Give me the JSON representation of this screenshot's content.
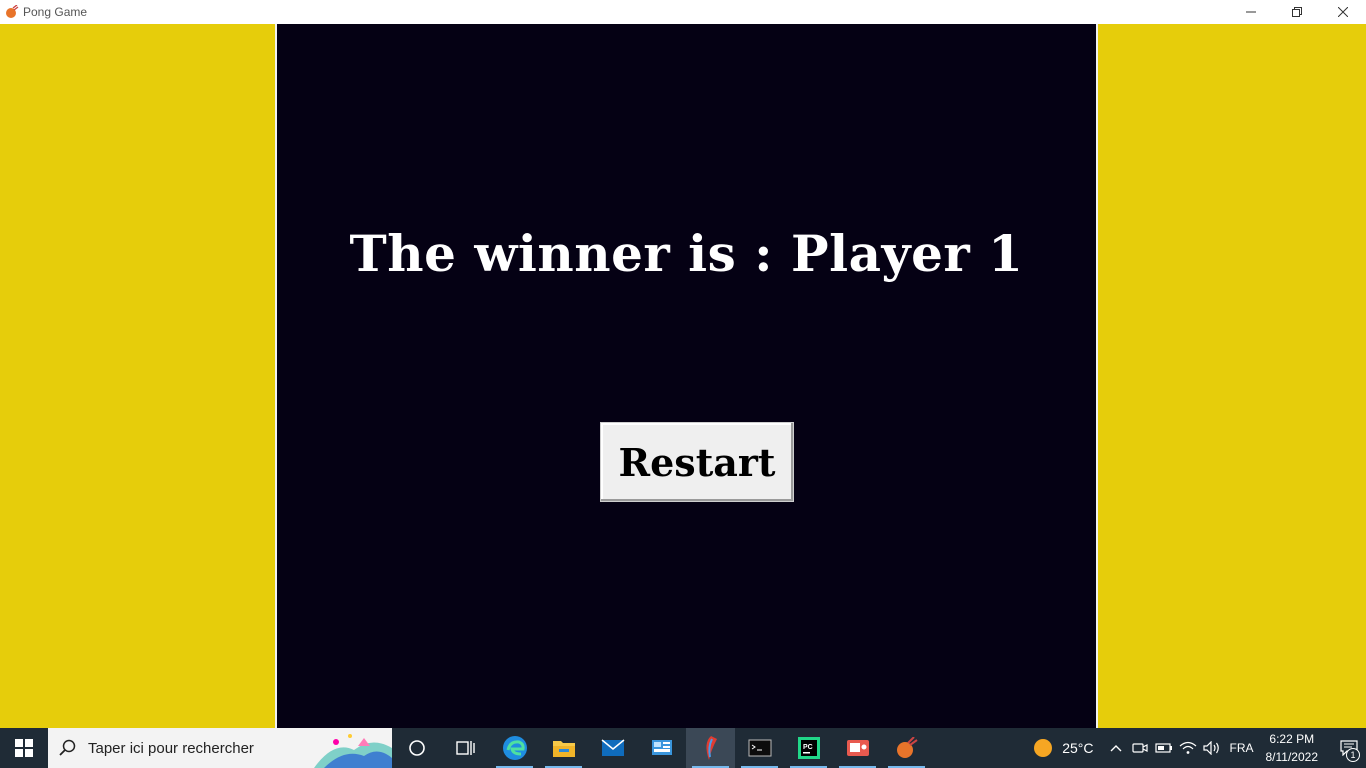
{
  "window": {
    "title": "Pong Game",
    "app_icon": "pong-app-icon"
  },
  "game": {
    "winner_text": "The winner is : Player 1",
    "restart_label": "Restart",
    "colors": {
      "side_panels": "#e6cd0b",
      "canvas": "#050114",
      "text": "#ffffff",
      "button": "#efefef"
    }
  },
  "taskbar": {
    "search_placeholder": "Taper ici pour rechercher",
    "apps": [
      {
        "name": "cortana-icon",
        "active": false
      },
      {
        "name": "task-view-icon",
        "active": false
      },
      {
        "name": "edge-icon",
        "active": false
      },
      {
        "name": "file-explorer-icon",
        "active": false
      },
      {
        "name": "mail-icon",
        "active": false
      },
      {
        "name": "control-panel-icon",
        "active": false
      },
      {
        "name": "python-feather-icon",
        "active": true
      },
      {
        "name": "terminal-icon",
        "active": false
      },
      {
        "name": "pycharm-icon",
        "active": false
      },
      {
        "name": "screen-recorder-icon",
        "active": false
      },
      {
        "name": "pong-taskbar-icon",
        "active": false
      }
    ],
    "weather_temp": "25°C",
    "language": "FRA",
    "time": "6:22 PM",
    "date": "8/11/2022",
    "notification_count": "1"
  }
}
